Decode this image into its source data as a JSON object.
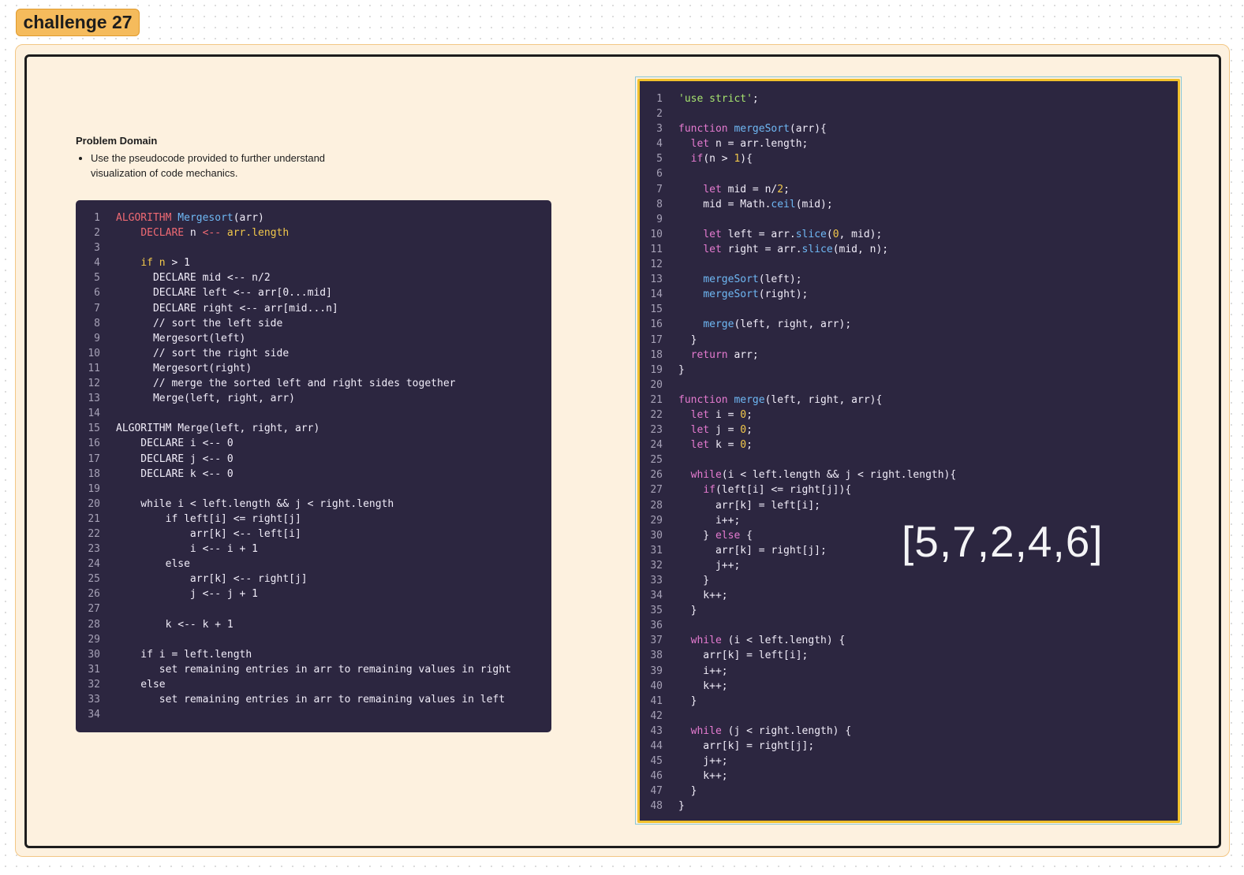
{
  "title": "challenge 27",
  "problem": {
    "heading": "Problem Domain",
    "bullets": [
      "Use the pseudocode provided to further understand visualization of code mechanics."
    ]
  },
  "array_label": "[5,7,2,4,6]",
  "colors": {
    "tag_bg": "#f5bb5c",
    "section_bg": "#fdf1df",
    "code_bg": "#2c2640",
    "js_border": "#f0c02c"
  },
  "pseudocode": [
    "ALGORITHM Mergesort(arr)",
    "    DECLARE n <-- arr.length",
    "",
    "    if n > 1",
    "      DECLARE mid <-- n/2",
    "      DECLARE left <-- arr[0...mid]",
    "      DECLARE right <-- arr[mid...n]",
    "      // sort the left side",
    "      Mergesort(left)",
    "      // sort the right side",
    "      Mergesort(right)",
    "      // merge the sorted left and right sides together",
    "      Merge(left, right, arr)",
    "",
    "ALGORITHM Merge(left, right, arr)",
    "    DECLARE i <-- 0",
    "    DECLARE j <-- 0",
    "    DECLARE k <-- 0",
    "",
    "    while i < left.length && j < right.length",
    "        if left[i] <= right[j]",
    "            arr[k] <-- left[i]",
    "            i <-- i + 1",
    "        else",
    "            arr[k] <-- right[j]",
    "            j <-- j + 1",
    "",
    "        k <-- k + 1",
    "",
    "    if i = left.length",
    "       set remaining entries in arr to remaining values in right",
    "    else",
    "       set remaining entries in arr to remaining values in left",
    ""
  ],
  "javascript": [
    "'use strict';",
    "",
    "function mergeSort(arr){",
    "  let n = arr.length;",
    "  if(n > 1){",
    "",
    "    let mid = n/2;",
    "    mid = Math.ceil(mid);",
    "",
    "    let left = arr.slice(0, mid);",
    "    let right = arr.slice(mid, n);",
    "",
    "    mergeSort(left);",
    "    mergeSort(right);",
    "",
    "    merge(left, right, arr);",
    "  }",
    "  return arr;",
    "}",
    "",
    "function merge(left, right, arr){",
    "  let i = 0;",
    "  let j = 0;",
    "  let k = 0;",
    "",
    "  while(i < left.length && j < right.length){",
    "    if(left[i] <= right[j]){",
    "      arr[k] = left[i];",
    "      i++;",
    "    } else {",
    "      arr[k] = right[j];",
    "      j++;",
    "    }",
    "    k++;",
    "  }",
    "",
    "  while (i < left.length) {",
    "    arr[k] = left[i];",
    "    i++;",
    "    k++;",
    "  }",
    "",
    "  while (j < right.length) {",
    "    arr[k] = right[j];",
    "    j++;",
    "    k++;",
    "  }",
    "}"
  ]
}
